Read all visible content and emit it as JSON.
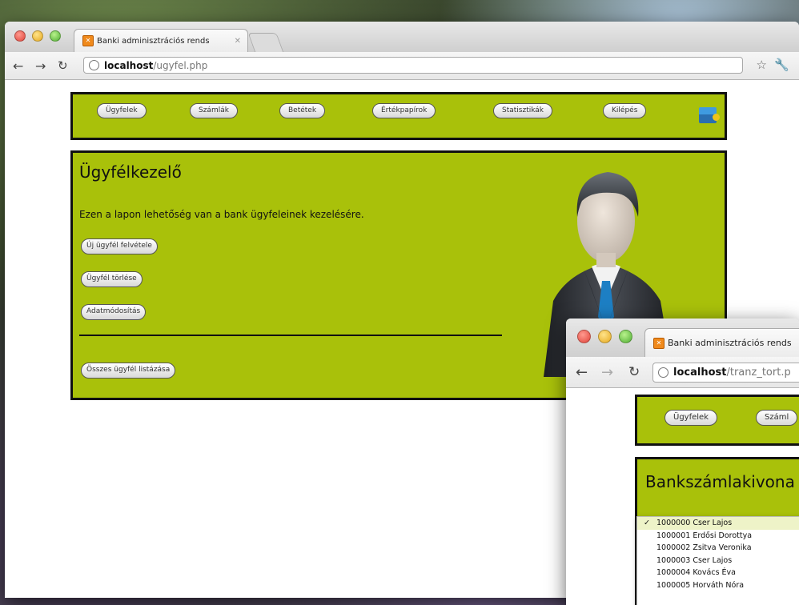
{
  "window1": {
    "tab_title": "Banki adminisztrációs rends",
    "url_host": "localhost",
    "url_path": "/ugyfel.php",
    "menu": [
      "Ügyfelek",
      "Számlák",
      "Betétek",
      "Értékpapírok",
      "Statisztikák",
      "Kilépés"
    ],
    "panel": {
      "title": "Ügyfélkezelő",
      "description": "Ezen a lapon lehetőség van a bank ügyfeleinek kezelésére.",
      "buttons": [
        "Új ügyfél felvétele",
        "Ügyfél törlése",
        "Adatmódosítás"
      ],
      "list_all_button": "Összes ügyfél listázása"
    }
  },
  "window2": {
    "tab_title": "Banki adminisztrációs rends",
    "url_host": "localhost",
    "url_path": "/tranz_tort.p",
    "menu": [
      "Ügyfelek",
      "Száml"
    ],
    "panel_title": "Bankszámlakivona",
    "dropdown_items": [
      {
        "label": "1000000 Cser Lajos",
        "checked": true
      },
      {
        "label": "1000001 Erdősi Dorottya",
        "checked": false
      },
      {
        "label": "1000002 Zsitva Veronika",
        "checked": false
      },
      {
        "label": "1000003 Cser Lajos",
        "checked": false
      },
      {
        "label": "1000004 Kovács Éva",
        "checked": false
      },
      {
        "label": "1000005 Horváth Nóra",
        "checked": false
      }
    ]
  },
  "colors": {
    "panel_green": "#a9c10a",
    "border": "#111111"
  },
  "icons": {
    "menu_flag": "flag-icon",
    "avatar": "businessman-icon",
    "bookmark": "star-icon",
    "settings": "wrench-icon"
  }
}
